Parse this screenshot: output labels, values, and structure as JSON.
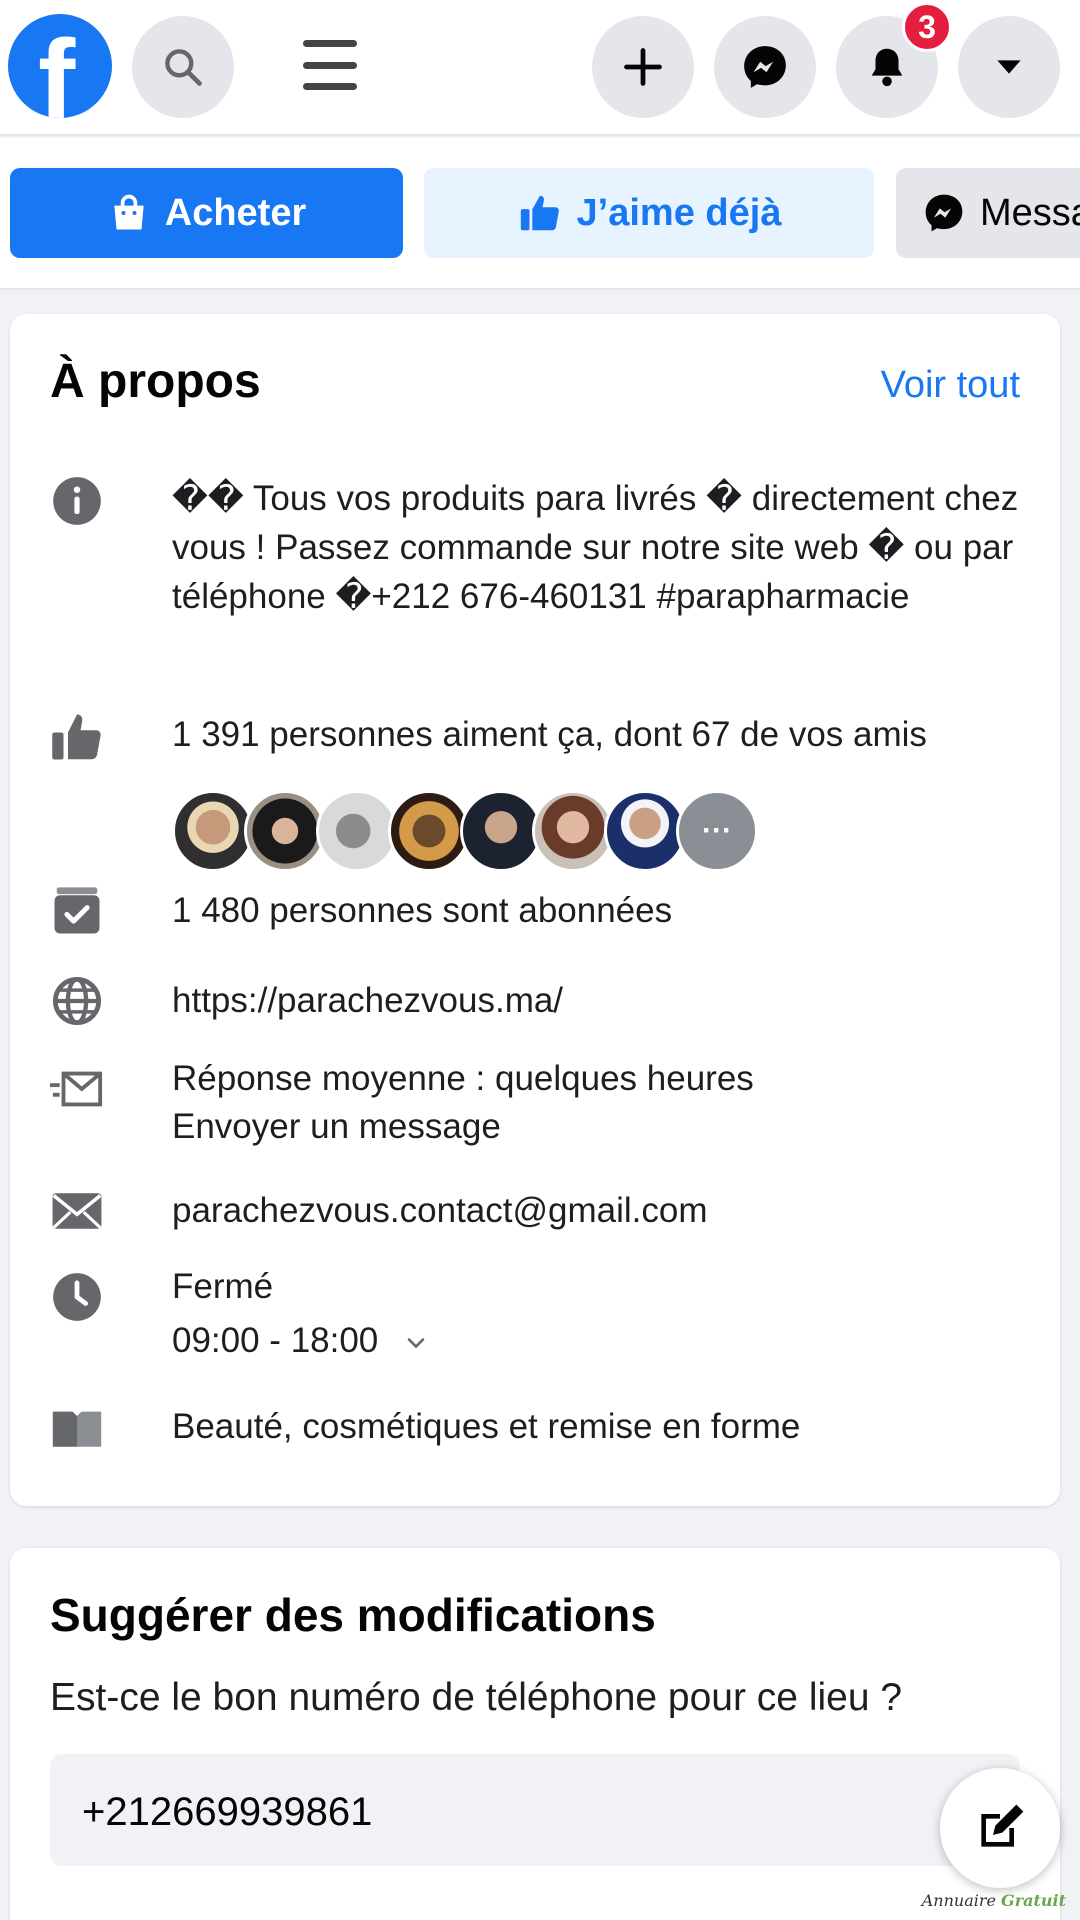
{
  "topbar": {
    "logo_letter": "f",
    "notification_count": "3",
    "icons": [
      "facebook-logo",
      "search-icon",
      "menu-icon",
      "plus-icon",
      "messenger-icon",
      "bell-icon",
      "caret-down-icon"
    ]
  },
  "actions": {
    "buy_label": "Acheter",
    "like_label": "J’aime déjà",
    "message_label": "Message"
  },
  "about": {
    "title": "À propos",
    "see_all": "Voir tout",
    "description": "�� Tous vos produits para livrés � directement chez vous ! Passez commande sur notre site web � ou par téléphone �+212 676-460131 #parapharmacie",
    "likes": "1 391 personnes aiment ça, dont 67 de vos amis",
    "followers": "1 480 personnes sont abonnées",
    "website": "https://parachezvous.ma/",
    "response_time": "Réponse moyenne : quelques heures",
    "send_message": "Envoyer un message",
    "email": "parachezvous.contact@gmail.com",
    "status": "Fermé",
    "hours": "09:00 - 18:00",
    "category": "Beauté, cosmétiques et remise en forme",
    "more_friends": "···"
  },
  "suggest": {
    "title": "Suggérer des modifications",
    "question": "Est-ce le bon numéro de téléphone pour ce lieu ?",
    "phone": "+212669939861"
  },
  "colors": {
    "brand": "#1877f2",
    "closed": "#e41e3f",
    "background": "#f0f2f5"
  }
}
